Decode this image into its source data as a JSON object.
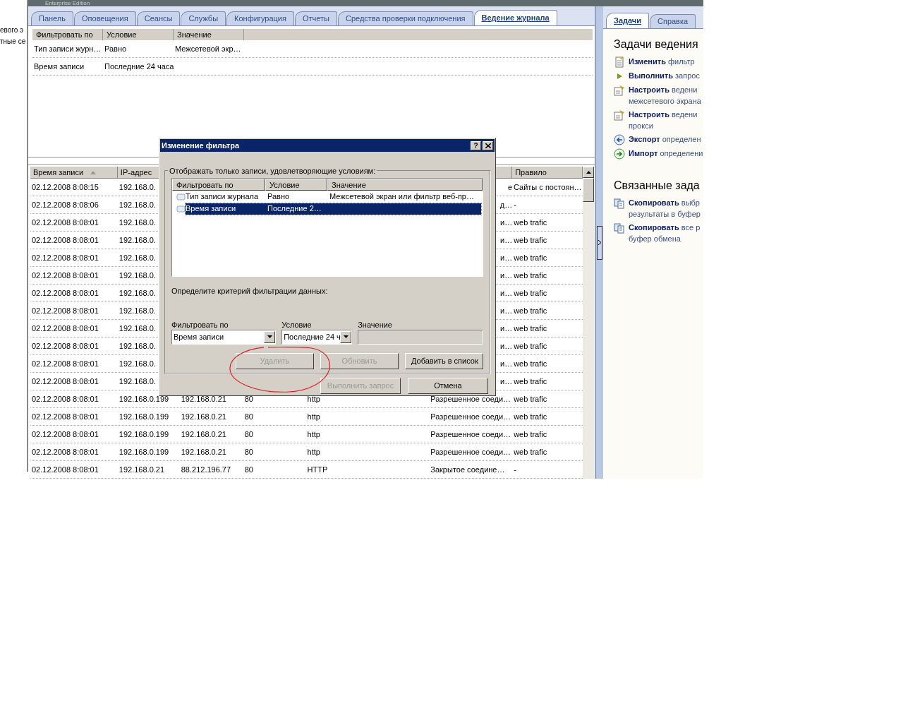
{
  "background_window": {
    "lines": [
      "евого э",
      "тные се"
    ]
  },
  "header": {
    "edition": "Enterprise Edition"
  },
  "tabs": [
    {
      "label": "Панель",
      "selected": false
    },
    {
      "label": "Оповещения",
      "selected": false
    },
    {
      "label": "Сеансы",
      "selected": false
    },
    {
      "label": "Службы",
      "selected": false
    },
    {
      "label": "Конфигурация",
      "selected": false
    },
    {
      "label": "Отчеты",
      "selected": false
    },
    {
      "label": "Средства проверки подключения",
      "selected": false
    },
    {
      "label": "Ведение журнала",
      "selected": true
    }
  ],
  "filter_summary": {
    "columns": [
      "Фильтровать по",
      "Условие",
      "Значение"
    ],
    "rows": [
      [
        "Тип записи журн…",
        "Равно",
        "Межсетевой экр…"
      ],
      [
        "Время записи",
        "Последние 24 часа"
      ]
    ]
  },
  "log_table": {
    "header": {
      "column_1": {
        "label": "Время записи",
        "sorted": true
      },
      "column_2": {
        "label": "IP-адрес"
      },
      "column_7": {
        "label": "Правило"
      }
    },
    "rows": [
      {
        "column_1": "02.12.2008 8:08:15",
        "column_2": "192.168.0.",
        "column_6": "е",
        "column_7": "Сайты с постоян…"
      },
      {
        "column_1": "02.12.2008 8:08:06",
        "column_2": "192.168.0.",
        "column_6": "д…",
        "column_7": "-"
      },
      {
        "column_1": "02.12.2008 8:08:01",
        "column_2": "192.168.0.",
        "column_6": "и…",
        "column_7": "web trafic"
      },
      {
        "column_1": "02.12.2008 8:08:01",
        "column_2": "192.168.0.",
        "column_6": "и…",
        "column_7": "web trafic"
      },
      {
        "column_1": "02.12.2008 8:08:01",
        "column_2": "192.168.0.",
        "column_6": "и…",
        "column_7": "web trafic"
      },
      {
        "column_1": "02.12.2008 8:08:01",
        "column_2": "192.168.0.",
        "column_6": "и…",
        "column_7": "web trafic"
      },
      {
        "column_1": "02.12.2008 8:08:01",
        "column_2": "192.168.0.",
        "column_6": "и…",
        "column_7": "web trafic"
      },
      {
        "column_1": "02.12.2008 8:08:01",
        "column_2": "192.168.0.",
        "column_6": "и…",
        "column_7": "web trafic"
      },
      {
        "column_1": "02.12.2008 8:08:01",
        "column_2": "192.168.0.",
        "column_6": "и…",
        "column_7": "web trafic"
      },
      {
        "column_1": "02.12.2008 8:08:01",
        "column_2": "192.168.0.",
        "column_6": "и…",
        "column_7": "web trafic"
      },
      {
        "column_1": "02.12.2008 8:08:01",
        "column_2": "192.168.0.",
        "column_6": "и…",
        "column_7": "web trafic"
      },
      {
        "column_1": "02.12.2008 8:08:01",
        "column_2": "192.168.0.",
        "column_6": "и…",
        "column_7": "web trafic"
      },
      {
        "column_1": "02.12.2008 8:08:01",
        "column_2": "192.168.0.199",
        "column_3": "192.168.0.21",
        "column_4": "80",
        "column_5": "http",
        "column_6": "Разрешенное соеди…",
        "column_7": "web trafic"
      },
      {
        "column_1": "02.12.2008 8:08:01",
        "column_2": "192.168.0.199",
        "column_3": "192.168.0.21",
        "column_4": "80",
        "column_5": "http",
        "column_6": "Разрешенное соеди…",
        "column_7": "web trafic"
      },
      {
        "column_1": "02.12.2008 8:08:01",
        "column_2": "192.168.0.199",
        "column_3": "192.168.0.21",
        "column_4": "80",
        "column_5": "http",
        "column_6": "Разрешенное соеди…",
        "column_7": "web trafic"
      },
      {
        "column_1": "02.12.2008 8:08:01",
        "column_2": "192.168.0.199",
        "column_3": "192.168.0.21",
        "column_4": "80",
        "column_5": "http",
        "column_6": "Разрешенное соеди…",
        "column_7": "web trafic"
      },
      {
        "column_1": "02.12.2008 8:08:01",
        "column_2": "192.168.0.21",
        "column_3": "88.212.196.77",
        "column_4": "80",
        "column_5": "HTTP",
        "column_6": "Закрытое соедине…",
        "column_7": "-"
      }
    ]
  },
  "task_pane": {
    "tabs": [
      {
        "label": "Задачи",
        "selected": true
      },
      {
        "label": "Справка",
        "selected": false
      }
    ],
    "sections": [
      {
        "title": "Задачи ведения",
        "items": [
          {
            "kind": "edit",
            "lines": [
              "**Изменить** фильтр"
            ]
          },
          {
            "kind": "run",
            "lines": [
              "**Выполнить** запрос"
            ]
          },
          {
            "kind": "configure",
            "lines": [
              "**Настроить** ведени",
              "межсетевого экрана"
            ]
          },
          {
            "kind": "configure",
            "lines": [
              "**Настроить** ведени",
              "прокси"
            ]
          },
          {
            "kind": "export",
            "lines": [
              "**Экспорт** определен"
            ]
          },
          {
            "kind": "import",
            "lines": [
              "**Импорт** определени"
            ]
          }
        ]
      },
      {
        "title": "Связанные зада",
        "items": [
          {
            "kind": "copy",
            "lines": [
              "**Скопировать** выбр",
              "результаты в буфер"
            ]
          },
          {
            "kind": "copy",
            "lines": [
              "**Скопировать** все р",
              "буфер обмена"
            ]
          }
        ]
      }
    ]
  },
  "dialog": {
    "title": "Изменение фильтра",
    "help_button": "?",
    "group_label": "Отображать только записи, удовлетворяющие условиям:",
    "list": {
      "columns": [
        "Фильтровать по",
        "Условие",
        "Значение"
      ],
      "rows": [
        {
          "cells": [
            "Тип записи журнала",
            "Равно",
            "Межсетевой экран или фильтр веб-пр…"
          ],
          "selected": false
        },
        {
          "cells": [
            "Время записи",
            "Последние 2…"
          ],
          "selected": true
        }
      ]
    },
    "criteria_label": "Определите критерий фильтрации данных:",
    "fields": [
      {
        "kind": "dropdown",
        "label": "Фильтровать по",
        "value": "Время записи",
        "disabled": false
      },
      {
        "kind": "dropdown",
        "label": "Условие",
        "value": "Последние 24 ч",
        "disabled": false
      },
      {
        "kind": "text",
        "label": "Значение",
        "disabled": true
      }
    ],
    "buttons": [
      {
        "label": "Удалить",
        "disabled": true
      },
      {
        "label": "Обновить",
        "disabled": true
      },
      {
        "label": "Добавить в список",
        "disabled": false
      }
    ],
    "footer_buttons": [
      {
        "label": "Выполнить запрос",
        "disabled": true
      },
      {
        "label": "Отмена",
        "disabled": false
      }
    ]
  }
}
